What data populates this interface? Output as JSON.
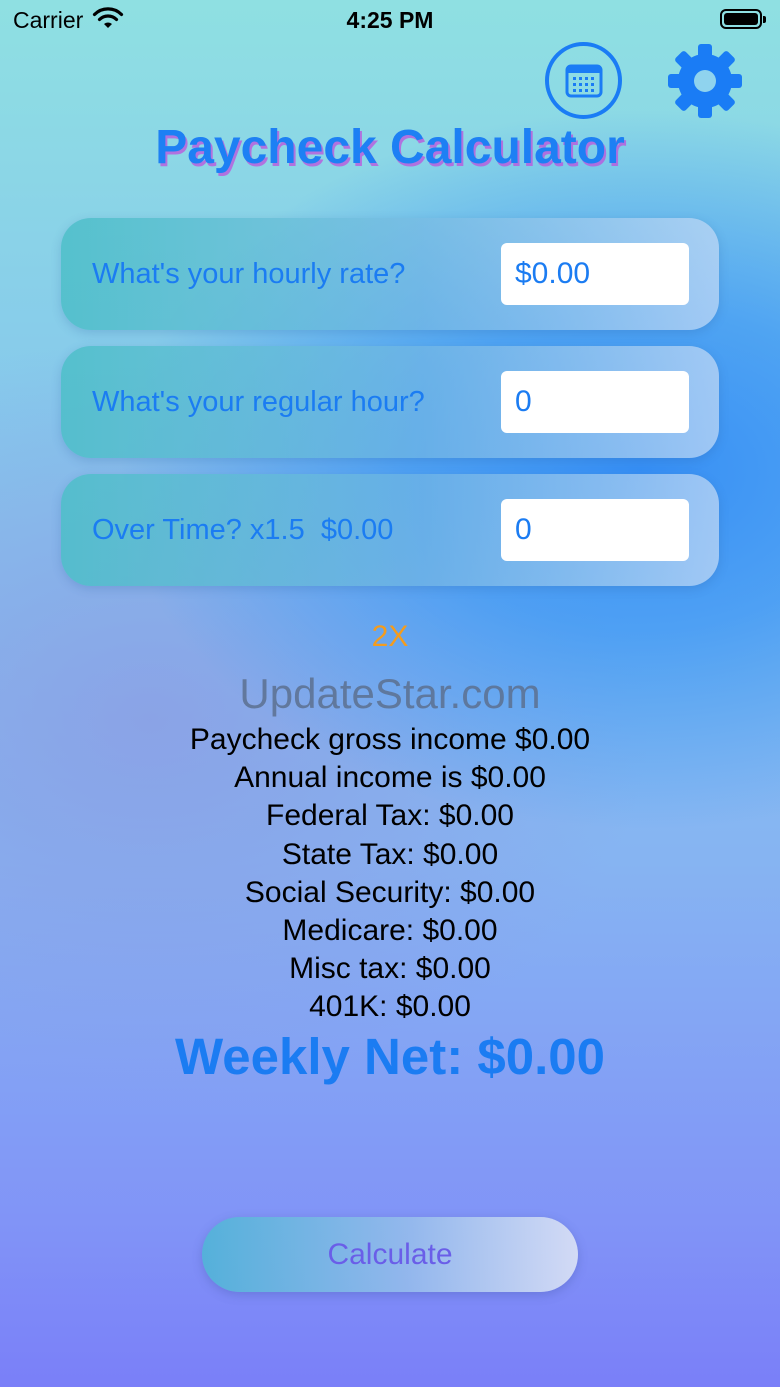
{
  "status_bar": {
    "carrier": "Carrier",
    "time": "4:25 PM",
    "wifi_icon": "wifi-icon",
    "battery_icon": "battery-icon"
  },
  "header": {
    "title": "Paycheck Calculator",
    "calendar_icon": "calendar-icon",
    "settings_icon": "gear-icon"
  },
  "inputs": [
    {
      "label": "What's your hourly rate?",
      "value": "$0.00"
    },
    {
      "label": "What's your regular hour?",
      "value": "0"
    },
    {
      "label": "Over Time? x1.5  $0.00",
      "value": "0"
    }
  ],
  "multiplier": "2X",
  "watermark": "UpdateStar.com",
  "results": {
    "gross_income": "Paycheck gross income $0.00",
    "annual_income": "Annual income is $0.00",
    "federal_tax": "Federal Tax: $0.00",
    "state_tax": "State Tax: $0.00",
    "social_security": "Social Security: $0.00",
    "medicare": "Medicare: $0.00",
    "misc_tax": "Misc tax: $0.00",
    "k401": "401K: $0.00"
  },
  "weekly_net": "Weekly Net: $0.00",
  "calculate_label": "Calculate",
  "colors": {
    "accent_blue": "#1b7cf2",
    "title_shadow": "#be50dc",
    "multiplier_orange": "#f39c1e",
    "button_text_purple": "#6a5ee8"
  }
}
